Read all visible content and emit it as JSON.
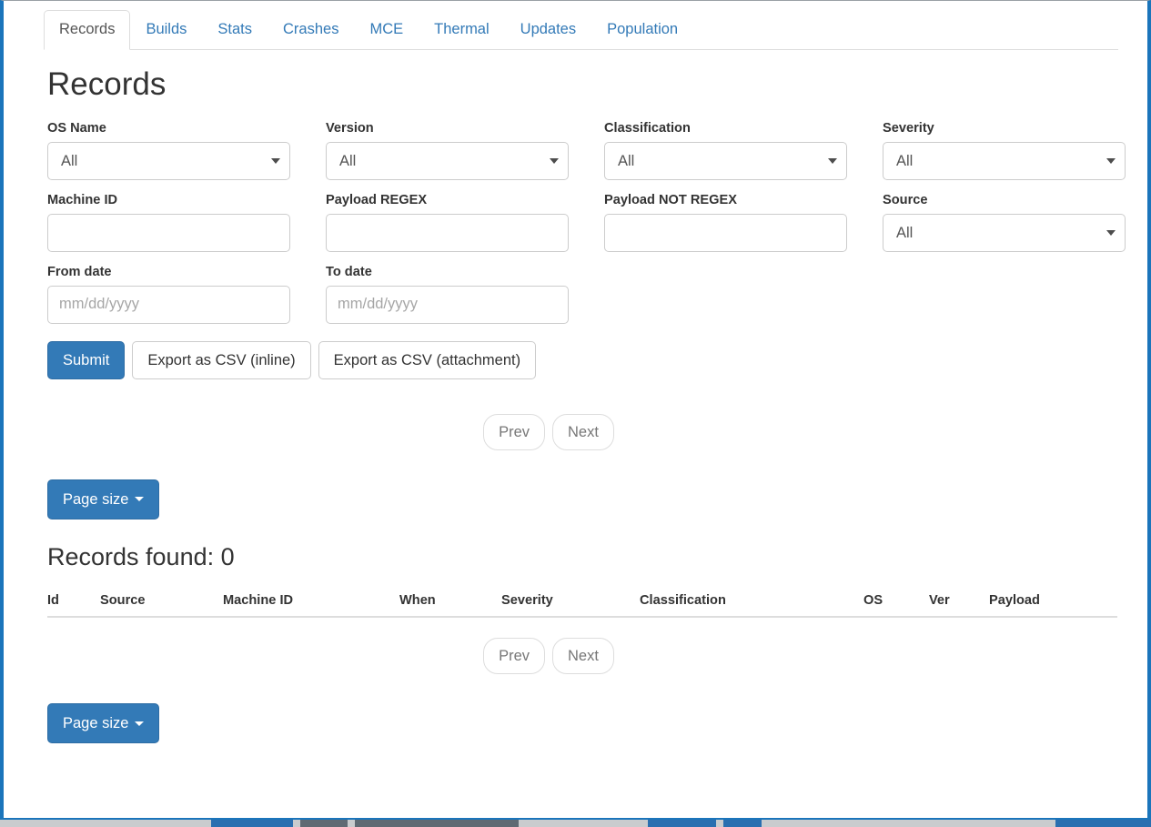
{
  "tabs": [
    {
      "label": "Records",
      "active": true
    },
    {
      "label": "Builds",
      "active": false
    },
    {
      "label": "Stats",
      "active": false
    },
    {
      "label": "Crashes",
      "active": false
    },
    {
      "label": "MCE",
      "active": false
    },
    {
      "label": "Thermal",
      "active": false
    },
    {
      "label": "Updates",
      "active": false
    },
    {
      "label": "Population",
      "active": false
    }
  ],
  "page": {
    "title": "Records",
    "results_title": "Records found: 0"
  },
  "filters": {
    "os_name": {
      "label": "OS Name",
      "value": "All",
      "type": "select"
    },
    "version": {
      "label": "Version",
      "value": "All",
      "type": "select"
    },
    "classification": {
      "label": "Classification",
      "value": "All",
      "type": "select"
    },
    "severity": {
      "label": "Severity",
      "value": "All",
      "type": "select"
    },
    "machine_id": {
      "label": "Machine ID",
      "value": "",
      "placeholder": "",
      "type": "text"
    },
    "payload_regex": {
      "label": "Payload REGEX",
      "value": "",
      "placeholder": "",
      "type": "text"
    },
    "payload_not_regex": {
      "label": "Payload NOT REGEX",
      "value": "",
      "placeholder": "",
      "type": "text"
    },
    "source": {
      "label": "Source",
      "value": "All",
      "type": "select"
    },
    "from_date": {
      "label": "From date",
      "value": "",
      "placeholder": "mm/dd/yyyy",
      "type": "date"
    },
    "to_date": {
      "label": "To date",
      "value": "",
      "placeholder": "mm/dd/yyyy",
      "type": "date"
    }
  },
  "actions": {
    "submit": "Submit",
    "export_inline": "Export as CSV (inline)",
    "export_attachment": "Export as CSV (attachment)"
  },
  "pagination": {
    "prev": "Prev",
    "next": "Next",
    "page_size": "Page size"
  },
  "table": {
    "columns": [
      "Id",
      "Source",
      "Machine ID",
      "When",
      "Severity",
      "Classification",
      "OS",
      "Ver",
      "Payload"
    ],
    "rows": []
  },
  "colors": {
    "primary": "#337ab7",
    "link": "#337ab7",
    "text": "#333333",
    "muted": "#777777",
    "border": "#cccccc",
    "window_border": "#1b75bb"
  }
}
